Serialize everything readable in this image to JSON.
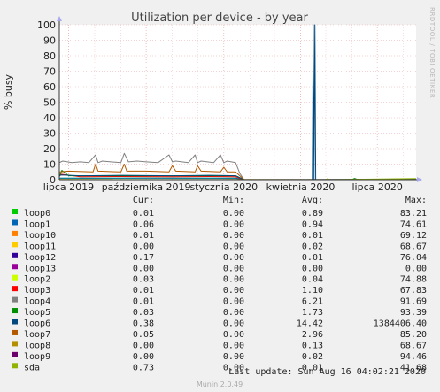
{
  "chart_data": {
    "type": "line",
    "title": "Utilization per device - by year",
    "ylabel": "% busy",
    "ylim": [
      0,
      100
    ],
    "yticks": [
      0,
      10,
      20,
      30,
      40,
      50,
      60,
      70,
      80,
      90,
      100
    ],
    "xlim": [
      "2019-06-20",
      "2020-08-16"
    ],
    "xticks": [
      {
        "date": "2019-07-01",
        "label": "lipca 2019"
      },
      {
        "date": "2019-10-01",
        "label": "października 2019"
      },
      {
        "date": "2020-01-01",
        "label": "stycznia 2020"
      },
      {
        "date": "2020-04-01",
        "label": "kwietnia 2020"
      },
      {
        "date": "2020-07-01",
        "label": "lipca 2020"
      }
    ],
    "grid": true,
    "side_label": "RRDTOOL / TOBI OETIKER",
    "columns": [
      "Cur:",
      "Min:",
      "Avg:",
      "Max:"
    ],
    "series": [
      {
        "name": "loop0",
        "color": "#00cc00",
        "cur": "0.01",
        "min": "0.00",
        "avg": "0.89",
        "max": "83.21",
        "x": [
          "2019-06-20",
          "2019-08-01",
          "2019-10-01",
          "2019-12-01",
          "2020-01-15",
          "2020-01-25",
          "2020-08-16"
        ],
        "y": [
          0.9,
          0.9,
          1.0,
          0.9,
          0.9,
          0.0,
          0.01
        ]
      },
      {
        "name": "loop1",
        "color": "#0066b3",
        "cur": "0.06",
        "min": "0.00",
        "avg": "0.94",
        "max": "74.61",
        "x": [
          "2019-06-20",
          "2019-09-01",
          "2019-12-01",
          "2020-01-15",
          "2020-01-25",
          "2020-08-16"
        ],
        "y": [
          1.0,
          1.0,
          1.0,
          1.0,
          0.0,
          0.06
        ]
      },
      {
        "name": "loop10",
        "color": "#ff8000",
        "cur": "0.01",
        "min": "0.00",
        "avg": "0.01",
        "max": "69.12",
        "x": [
          "2019-06-20",
          "2020-08-16"
        ],
        "y": [
          0.01,
          0.01
        ]
      },
      {
        "name": "loop11",
        "color": "#ffcc00",
        "cur": "0.00",
        "min": "0.00",
        "avg": "0.02",
        "max": "68.67",
        "x": [
          "2019-06-20",
          "2020-08-16"
        ],
        "y": [
          0.02,
          0.0
        ]
      },
      {
        "name": "loop12",
        "color": "#330099",
        "cur": "0.17",
        "min": "0.00",
        "avg": "0.01",
        "max": "76.04",
        "x": [
          "2019-06-20",
          "2020-08-16"
        ],
        "y": [
          0.01,
          0.17
        ]
      },
      {
        "name": "loop13",
        "color": "#990099",
        "cur": "0.00",
        "min": "0.00",
        "avg": "0.00",
        "max": "0.00",
        "x": [
          "2019-06-20",
          "2020-08-16"
        ],
        "y": [
          0.0,
          0.0
        ]
      },
      {
        "name": "loop2",
        "color": "#ccff00",
        "cur": "0.03",
        "min": "0.00",
        "avg": "0.04",
        "max": "74.88",
        "x": [
          "2019-06-20",
          "2020-08-16"
        ],
        "y": [
          0.04,
          0.03
        ]
      },
      {
        "name": "loop3",
        "color": "#ff0000",
        "cur": "0.01",
        "min": "0.00",
        "avg": "1.10",
        "max": "67.83",
        "x": [
          "2019-06-20",
          "2019-06-22",
          "2019-07-15",
          "2019-09-01",
          "2019-11-01",
          "2019-12-15",
          "2020-01-15",
          "2020-01-25",
          "2020-08-16"
        ],
        "y": [
          2.0,
          3.5,
          1.8,
          2.0,
          1.8,
          2.0,
          1.8,
          0.0,
          0.01
        ]
      },
      {
        "name": "loop4",
        "color": "#808080",
        "cur": "0.01",
        "min": "0.00",
        "avg": "6.21",
        "max": "91.69",
        "x": [
          "2019-06-20",
          "2019-06-24",
          "2019-07-05",
          "2019-07-15",
          "2019-07-25",
          "2019-08-02",
          "2019-08-05",
          "2019-08-10",
          "2019-08-20",
          "2019-09-01",
          "2019-09-05",
          "2019-09-10",
          "2019-09-20",
          "2019-10-01",
          "2019-10-15",
          "2019-10-28",
          "2019-11-01",
          "2019-11-05",
          "2019-11-20",
          "2019-11-28",
          "2019-12-01",
          "2019-12-05",
          "2019-12-20",
          "2019-12-28",
          "2020-01-01",
          "2020-01-05",
          "2020-01-15",
          "2020-01-20",
          "2020-01-25",
          "2020-08-16"
        ],
        "y": [
          11.0,
          12.0,
          11.0,
          11.5,
          11.0,
          16.0,
          11.0,
          12.0,
          11.5,
          11.0,
          17.0,
          11.5,
          12.0,
          11.5,
          11.0,
          16.0,
          11.5,
          12.0,
          11.0,
          16.0,
          11.0,
          12.0,
          11.0,
          16.0,
          11.0,
          12.0,
          11.0,
          4.0,
          0.0,
          0.01
        ]
      },
      {
        "name": "loop5",
        "color": "#008f00",
        "cur": "0.03",
        "min": "0.00",
        "avg": "1.73",
        "max": "93.39",
        "x": [
          "2019-06-20",
          "2019-06-23",
          "2019-07-01",
          "2019-08-01",
          "2019-10-01",
          "2019-12-01",
          "2020-01-15",
          "2020-01-25",
          "2020-06-01",
          "2020-06-04",
          "2020-06-08",
          "2020-08-16"
        ],
        "y": [
          2.0,
          6.0,
          2.5,
          2.5,
          2.5,
          2.5,
          2.5,
          0.0,
          0.0,
          0.8,
          0.0,
          0.03
        ]
      },
      {
        "name": "loop6",
        "color": "#00487d",
        "cur": "0.38",
        "min": "0.00",
        "avg": "14.42",
        "max": "1384406.40",
        "x": [
          "2019-06-20",
          "2019-06-22",
          "2019-07-15",
          "2019-09-01",
          "2019-11-01",
          "2019-12-15",
          "2020-01-15",
          "2020-01-25",
          "2020-04-15",
          "2020-04-16",
          "2020-04-17",
          "2020-04-18",
          "2020-04-19",
          "2020-08-16"
        ],
        "y": [
          2.5,
          3.0,
          2.5,
          2.8,
          2.5,
          2.8,
          2.5,
          0.0,
          0.0,
          100.0,
          0.0,
          100.0,
          0.0,
          0.38
        ]
      },
      {
        "name": "loop7",
        "color": "#b35a00",
        "cur": "0.05",
        "min": "0.00",
        "avg": "2.96",
        "max": "85.20",
        "x": [
          "2019-06-20",
          "2019-07-01",
          "2019-07-30",
          "2019-08-02",
          "2019-08-05",
          "2019-09-01",
          "2019-09-05",
          "2019-09-08",
          "2019-10-01",
          "2019-10-28",
          "2019-11-01",
          "2019-11-05",
          "2019-11-28",
          "2019-12-01",
          "2019-12-05",
          "2019-12-28",
          "2020-01-01",
          "2020-01-05",
          "2020-01-15",
          "2020-01-25",
          "2020-08-16"
        ],
        "y": [
          5.0,
          5.5,
          5.0,
          10.0,
          5.5,
          5.0,
          10.0,
          5.5,
          5.5,
          5.0,
          9.0,
          5.5,
          5.0,
          9.0,
          5.5,
          5.0,
          8.0,
          5.0,
          5.0,
          0.0,
          0.05
        ]
      },
      {
        "name": "loop8",
        "color": "#b38f00",
        "cur": "0.00",
        "min": "0.00",
        "avg": "0.13",
        "max": "68.67",
        "x": [
          "2019-06-20",
          "2020-08-16"
        ],
        "y": [
          0.13,
          0.0
        ]
      },
      {
        "name": "loop9",
        "color": "#6b006b",
        "cur": "0.00",
        "min": "0.00",
        "avg": "0.02",
        "max": "94.46",
        "x": [
          "2019-06-20",
          "2020-08-16"
        ],
        "y": [
          0.02,
          0.0
        ]
      },
      {
        "name": "sda",
        "color": "#8fb300",
        "cur": "0.73",
        "min": "0.00",
        "avg": "0.01",
        "max": "41.68",
        "x": [
          "2019-06-20",
          "2020-05-01",
          "2020-05-03",
          "2020-05-05",
          "2020-08-16"
        ],
        "y": [
          0.01,
          0.01,
          0.6,
          0.01,
          0.73
        ]
      }
    ],
    "last_update": "Last update: Sun Aug 16 04:02:21 2020",
    "footer": "Munin 2.0.49"
  }
}
